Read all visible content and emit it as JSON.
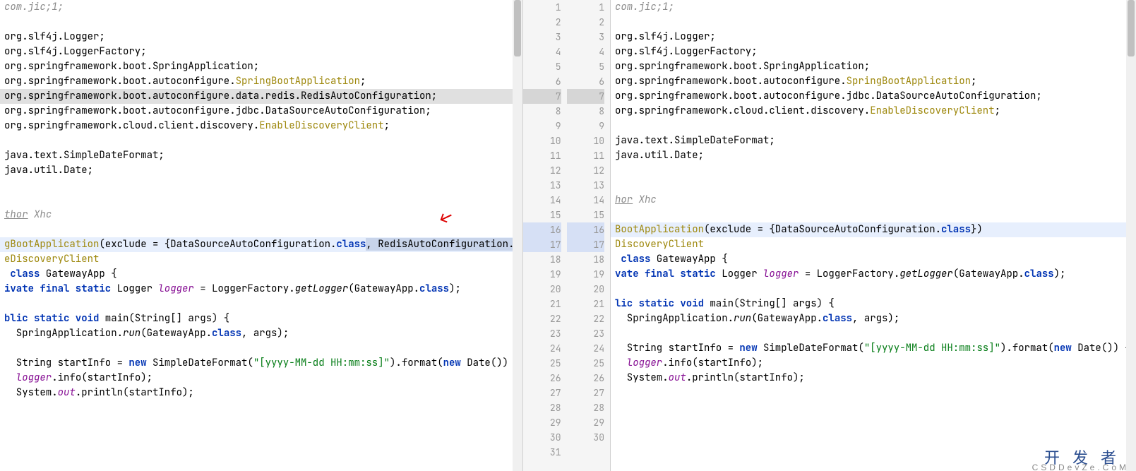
{
  "left": {
    "gutter": null,
    "lines": [
      {
        "cls": "",
        "html": "<span class='comment'>com.jic;1;</span>"
      },
      {
        "cls": "",
        "html": ""
      },
      {
        "cls": "",
        "html": "org.slf4j.Logger;"
      },
      {
        "cls": "",
        "html": "org.slf4j.LoggerFactory;"
      },
      {
        "cls": "",
        "html": "org.springframework.boot.SpringApplication;"
      },
      {
        "cls": "",
        "html": "org.springframework.boot.autoconfigure.<span class='anno'>SpringBootApplication</span>;"
      },
      {
        "cls": "hl-deleted",
        "html": "org.springframework.boot.autoconfigure.data.redis.RedisAutoConfiguration;"
      },
      {
        "cls": "",
        "html": "org.springframework.boot.autoconfigure.jdbc.DataSourceAutoConfiguration;"
      },
      {
        "cls": "",
        "html": "org.springframework.cloud.client.discovery.<span class='anno'>EnableDiscoveryClient</span>;"
      },
      {
        "cls": "",
        "html": ""
      },
      {
        "cls": "",
        "html": "java.text.SimpleDateFormat;"
      },
      {
        "cls": "",
        "html": "java.util.Date;"
      },
      {
        "cls": "",
        "html": ""
      },
      {
        "cls": "",
        "html": ""
      },
      {
        "cls": "",
        "html": "<span class='author'>thor</span> <span class='comment'>Xhc</span>"
      },
      {
        "cls": "",
        "html": ""
      },
      {
        "cls": "hl-change",
        "html": "<span class='anno'>gBootApplication</span>(exclude = {DataSourceAutoConfiguration.<span class='kw'>class</span><span class='hl-inline'>, RedisAutoConfiguration.</span><span class='kw hl-inline'>class</span>})"
      },
      {
        "cls": "",
        "html": "<span class='anno'>eDiscoveryClient</span>"
      },
      {
        "cls": "",
        "html": " <span class='kw'>class</span> GatewayApp {"
      },
      {
        "cls": "",
        "html": "<span class='kw'>ivate final static</span> Logger <span class='field'>logger</span> = LoggerFactory.<span class='static-call'>getLogger</span>(GatewayApp.<span class='kw'>class</span>);"
      },
      {
        "cls": "",
        "html": ""
      },
      {
        "cls": "",
        "html": "<span class='kw'>blic static void</span> main(String[] args) {"
      },
      {
        "cls": "",
        "html": "  SpringApplication.<span class='static-call'>run</span>(GatewayApp.<span class='kw'>class</span>, args);"
      },
      {
        "cls": "",
        "html": ""
      },
      {
        "cls": "",
        "html": "  String startInfo = <span class='kw'>new</span> SimpleDateFormat(<span class='str'>\"[yyyy-MM-dd HH:mm:ss]\"</span>).format(<span class='kw'>new</span> Date()) + <span class='str'>\"Gatew</span>"
      },
      {
        "cls": "",
        "html": "  <span class='field'>logger</span>.info(startInfo);"
      },
      {
        "cls": "",
        "html": "  System.<span class='field'>out</span>.println(startInfo);"
      }
    ]
  },
  "gutterLeft": [
    "1",
    "2",
    "3",
    "4",
    "5",
    "6",
    "7",
    "8",
    "9",
    "10",
    "11",
    "12",
    "13",
    "14",
    "15",
    "16",
    "17",
    "18",
    "19",
    "20",
    "21",
    "22",
    "23",
    "24",
    "25",
    "26",
    "27",
    "28",
    "29",
    "30",
    "31"
  ],
  "gutterRight": [
    "1",
    "2",
    "3",
    "4",
    "5",
    "6",
    "7",
    "8",
    "9",
    "10",
    "11",
    "12",
    "13",
    "14",
    "15",
    "16",
    "17",
    "18",
    "19",
    "20",
    "21",
    "22",
    "23",
    "24",
    "25",
    "26",
    "27",
    "28",
    "29",
    "30",
    ""
  ],
  "right": {
    "lines": [
      {
        "cls": "",
        "html": "<span class='comment'>com.jic;1;</span>"
      },
      {
        "cls": "",
        "html": ""
      },
      {
        "cls": "",
        "html": "org.slf4j.Logger;"
      },
      {
        "cls": "",
        "html": "org.slf4j.LoggerFactory;"
      },
      {
        "cls": "",
        "html": "org.springframework.boot.SpringApplication;"
      },
      {
        "cls": "",
        "html": "org.springframework.boot.autoconfigure.<span class='anno'>SpringBootApplication</span>;"
      },
      {
        "cls": "",
        "html": "org.springframework.boot.autoconfigure.jdbc.DataSourceAutoConfiguration;"
      },
      {
        "cls": "",
        "html": "org.springframework.cloud.client.discovery.<span class='anno'>EnableDiscoveryClient</span>;"
      },
      {
        "cls": "",
        "html": ""
      },
      {
        "cls": "",
        "html": "java.text.SimpleDateFormat;"
      },
      {
        "cls": "",
        "html": "java.util.Date;"
      },
      {
        "cls": "",
        "html": ""
      },
      {
        "cls": "",
        "html": ""
      },
      {
        "cls": "",
        "html": "<span class='author'>hor</span> <span class='comment'>Xhc</span>"
      },
      {
        "cls": "",
        "html": ""
      },
      {
        "cls": "hl-change",
        "html": "<span class='anno'>BootApplication</span>(exclude = {DataSourceAutoConfiguration.<span class='kw'>class</span>})"
      },
      {
        "cls": "",
        "html": "<span class='anno'>DiscoveryClient</span>"
      },
      {
        "cls": "",
        "html": " <span class='kw'>class</span> GatewayApp {"
      },
      {
        "cls": "",
        "html": "<span class='kw'>vate final static</span> Logger <span class='field'>logger</span> = LoggerFactory.<span class='static-call'>getLogger</span>(GatewayApp.<span class='kw'>class</span>);"
      },
      {
        "cls": "",
        "html": ""
      },
      {
        "cls": "",
        "html": "<span class='kw'>lic static void</span> main(String[] args) {"
      },
      {
        "cls": "",
        "html": "  SpringApplication.<span class='static-call'>run</span>(GatewayApp.<span class='kw'>class</span>, args);"
      },
      {
        "cls": "",
        "html": ""
      },
      {
        "cls": "",
        "html": "  String startInfo = <span class='kw'>new</span> SimpleDateFormat(<span class='str'>\"[yyyy-MM-dd HH:mm:ss]\"</span>).format(<span class='kw'>new</span> Date()) + <span class='str'>\"Gate</span>"
      },
      {
        "cls": "",
        "html": "  <span class='field'>logger</span>.info(startInfo);"
      },
      {
        "cls": "",
        "html": "  System.<span class='field'>out</span>.println(startInfo);"
      },
      {
        "cls": "",
        "html": ""
      },
      {
        "cls": "",
        "html": ""
      },
      {
        "cls": "",
        "html": ""
      },
      {
        "cls": "",
        "html": ""
      },
      {
        "cls": "",
        "html": ""
      }
    ]
  },
  "watermark": {
    "main": "开发者",
    "sub": "CSDDevZe.CoM"
  }
}
